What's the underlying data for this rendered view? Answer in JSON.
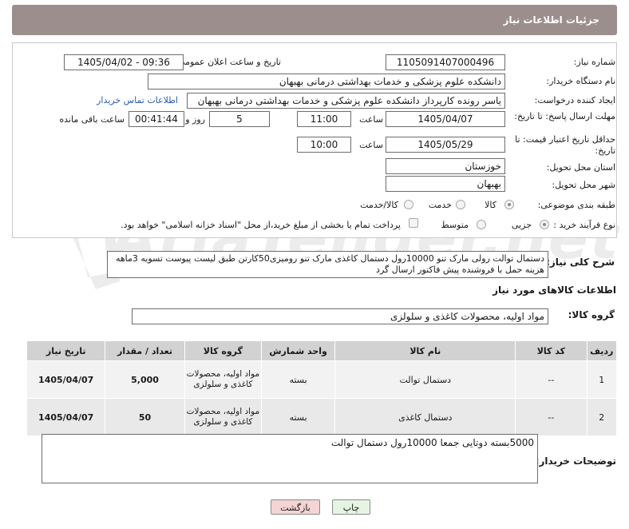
{
  "header": {
    "title": "جزئیات اطلاعات نیاز"
  },
  "form": {
    "need_number_label": "شماره نیاز:",
    "need_number": "1105091407000496",
    "announce_label": "تاریخ و ساعت اعلان عمومی:",
    "announce_value": "1405/04/02 - 09:36",
    "buyer_org_label": "نام دستگاه خریدار:",
    "buyer_org": "دانشکده علوم پزشکی و خدمات بهداشتی  درمانی بهبهان",
    "creator_label": "ایجاد کننده درخواست:",
    "creator": "یاسر رونده کارپرداز دانشکده علوم پزشکی و خدمات بهداشتی  درمانی بهبهان",
    "contact_link": "اطلاعات تماس خریدار",
    "deadline_label": "مهلت ارسال پاسخ: تا تاریخ:",
    "deadline_date": "1405/04/07",
    "time_label": "ساعت",
    "deadline_time": "11:00",
    "days_value": "5",
    "days_label": "روز و",
    "remaining_time": "00:41:44",
    "remaining_label": "ساعت باقی مانده",
    "validity_label": "حداقل تاریخ اعتبار قیمت: تا تاریخ:",
    "validity_date": "1405/05/29",
    "validity_time": "10:00",
    "province_label": "استان محل تحویل:",
    "province": "خوزستان",
    "city_label": "شهر محل تحویل:",
    "city": "بهبهان",
    "category_label": "طبقه بندی موضوعی:",
    "category_options": [
      "کالا",
      "خدمت",
      "کالا/خدمت"
    ],
    "process_label": "نوع فرآیند خرید :",
    "process_options": [
      "جزیی",
      "متوسط"
    ],
    "payment_note": "پرداخت تمام یا بخشی از مبلغ خرید،از محل \"اسناد خزانه اسلامی\" خواهد بود."
  },
  "description": {
    "label": "شرح کلی نیاز:",
    "text": "دستمال توالت رولی مارک تنو 10000رول دستمال کاغذی مارک تنو رومیزی50کارتن طبق لیست پیوست تسویه 3ماهه هزینه حمل با فروشنده پیش فاکتور ارسال گرد"
  },
  "goods": {
    "section_title": "اطلاعات کالاهای مورد نیاز",
    "group_label": "گروه کالا:",
    "group_value": "مواد اولیه، محصولات کاغذی و سلولزی",
    "columns": [
      "ردیف",
      "کد کالا",
      "نام کالا",
      "واحد شمارش",
      "گروه کالا",
      "تعداد / مقدار",
      "تاریخ نیاز"
    ],
    "rows": [
      [
        "1",
        "--",
        "دستمال توالت",
        "بسته",
        "مواد اولیه، محصولات کاغذی و سلولزی",
        "5,000",
        "1405/04/07"
      ],
      [
        "2",
        "--",
        "دستمال کاغذی",
        "بسته",
        "مواد اولیه، محصولات کاغذی و سلولزی",
        "50",
        "1405/04/07"
      ]
    ]
  },
  "buyer_notes": {
    "label": "توضیحات خریدار:",
    "text": "5000بسته دوتایی جمعا 10000رول دستمال توالت"
  },
  "buttons": {
    "print": "چاپ",
    "back": "بازگشت"
  },
  "watermark": {
    "text": "AriaTender.net"
  },
  "colors": {
    "header_bg": "#9d8e8e",
    "back_button_bg": "#f4d4d4",
    "print_button_bg": "#e6f4e4",
    "link": "#2a5db0"
  }
}
